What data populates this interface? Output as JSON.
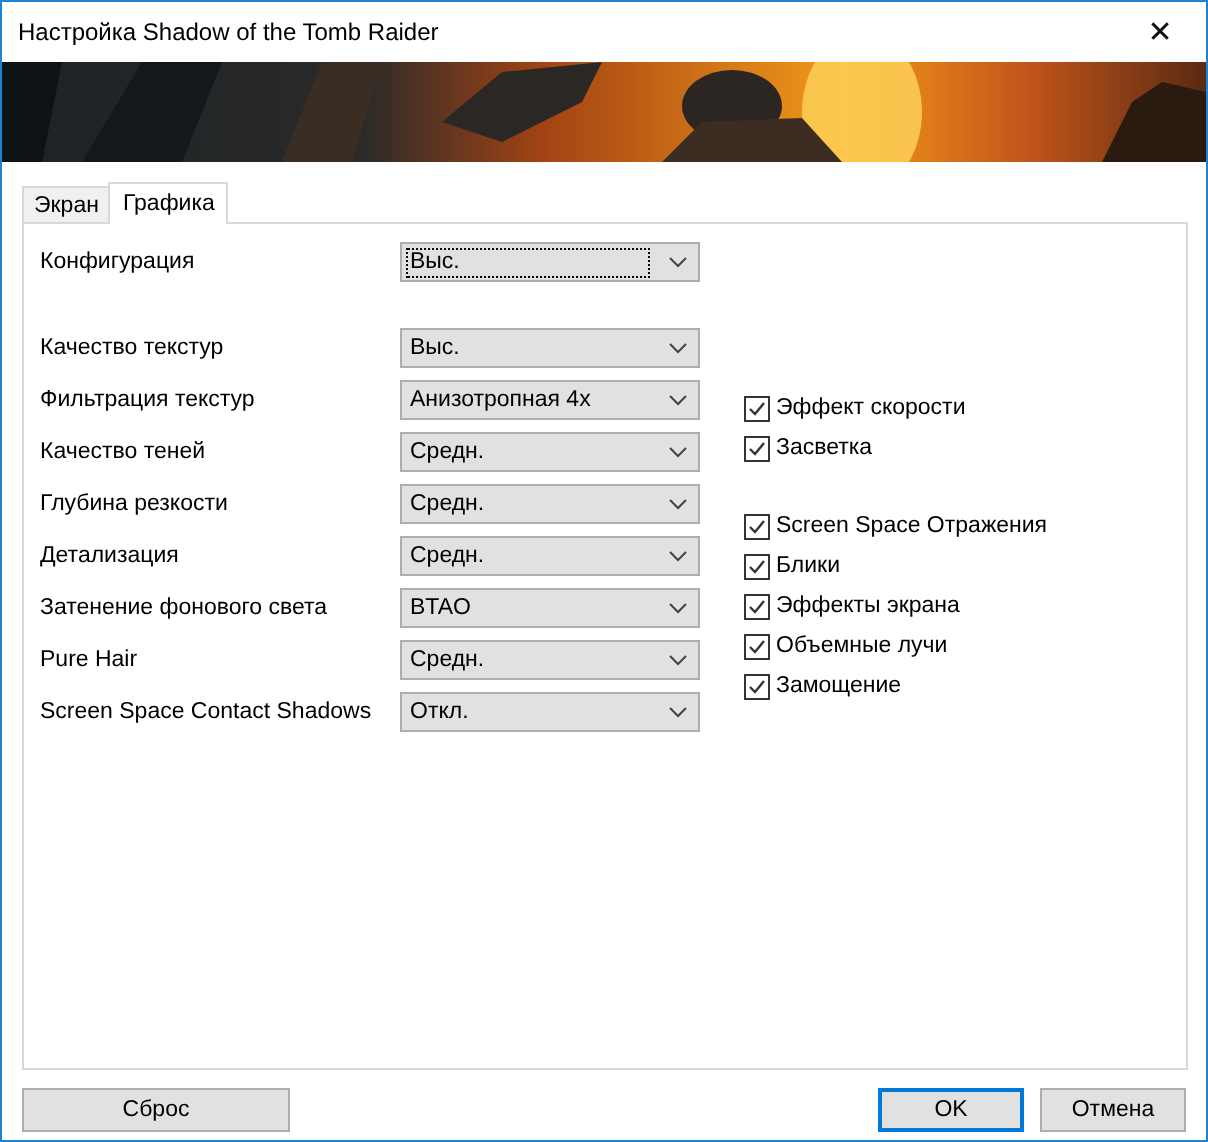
{
  "window": {
    "title": "Настройка Shadow of the Tomb Raider",
    "close": "✕"
  },
  "banner": {
    "kind": "picture"
  },
  "tabs": [
    {
      "label": "Экран",
      "selected": false
    },
    {
      "label": "Графика",
      "selected": true
    }
  ],
  "config": {
    "label": "Конфигурация",
    "value": "Выс.",
    "focused": true
  },
  "settings": [
    {
      "label": "Качество текстур",
      "value": "Выс."
    },
    {
      "label": "Фильтрация текстур",
      "value": "Анизотропная 4x"
    },
    {
      "label": "Качество теней",
      "value": "Средн."
    },
    {
      "label": "Глубина резкости",
      "value": "Средн."
    },
    {
      "label": "Детализация",
      "value": "Средн."
    },
    {
      "label": "Затенение фонового света",
      "value": "BTAO"
    },
    {
      "label": "Pure Hair",
      "value": "Средн."
    },
    {
      "label": "Screen Space Contact Shadows",
      "value": "Откл."
    }
  ],
  "checkbox_groups": [
    [
      {
        "label": "Эффект скорости",
        "checked": true
      },
      {
        "label": "Засветка",
        "checked": true
      }
    ],
    [
      {
        "label": "Screen Space Отражения",
        "checked": true
      },
      {
        "label": "Блики",
        "checked": true
      },
      {
        "label": "Эффекты экрана",
        "checked": true
      },
      {
        "label": "Объемные лучи",
        "checked": true
      },
      {
        "label": "Замощение",
        "checked": true
      }
    ]
  ],
  "buttons": [
    {
      "label": "Сброс",
      "default": false
    },
    {
      "label": "OK",
      "default": true
    },
    {
      "label": "Отмена",
      "default": false
    }
  ]
}
